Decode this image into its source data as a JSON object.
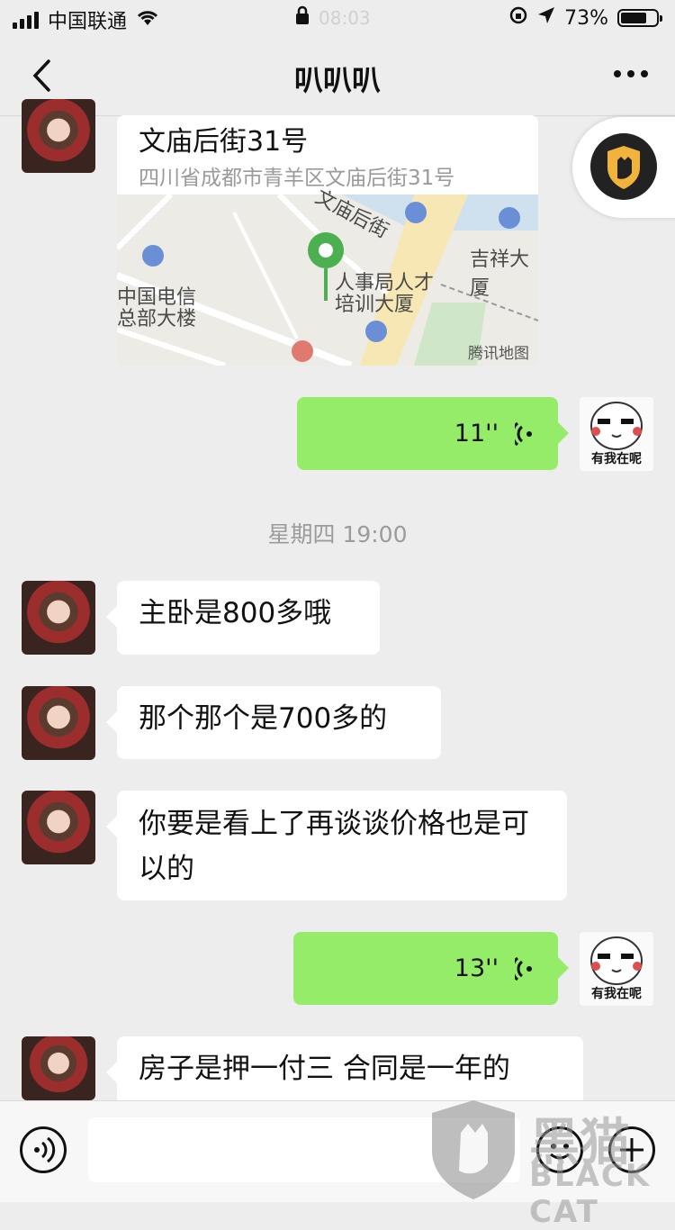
{
  "status_bar": {
    "carrier": "中国联通",
    "time": "08:03",
    "battery_percent": "73%",
    "battery_level": 0.73
  },
  "nav": {
    "title": "叭叭叭"
  },
  "location": {
    "title": "文庙后街31号",
    "address": "四川省成都市青羊区文庙后街31号",
    "map_labels": [
      "文庙后街",
      "人事局人才",
      "培训大厦",
      "吉祥大厦",
      "中国电信",
      "总部大楼",
      "腾讯地图"
    ]
  },
  "voice_messages": [
    {
      "duration": "11''",
      "sticker_caption": "有我在呢"
    },
    {
      "duration": "13''",
      "sticker_caption": "有我在呢"
    }
  ],
  "timestamp": "星期四 19:00",
  "incoming_messages": [
    "主卧是800多哦",
    "那个那个是700多的",
    "你要是看上了再谈谈价格也是可以的",
    "房子是押一付三  合同是一年的"
  ],
  "input": {
    "placeholder": ""
  },
  "watermark": {
    "logo_text": "黑猫",
    "english": "BLACK CAT"
  }
}
